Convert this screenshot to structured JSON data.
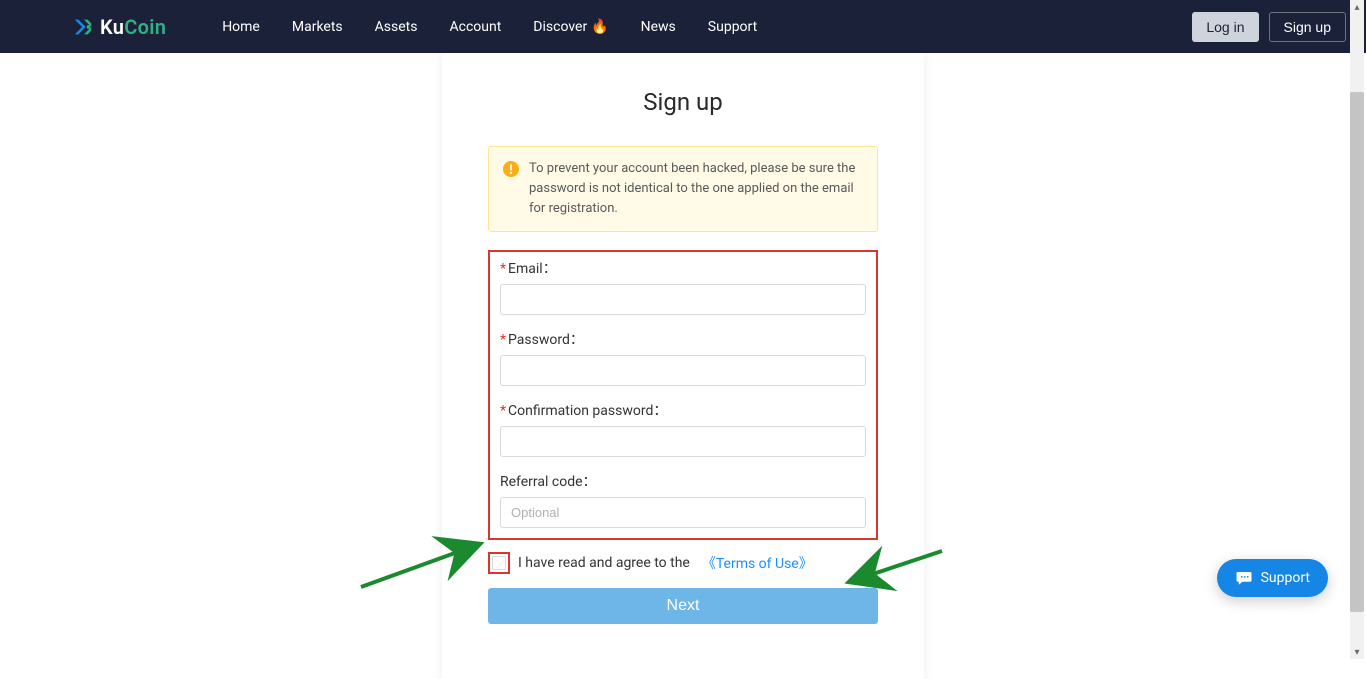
{
  "nav": {
    "brand_part1": "Ku",
    "brand_part2": "Coin",
    "links": [
      "Home",
      "Markets",
      "Assets",
      "Account",
      "Discover",
      "News",
      "Support"
    ],
    "login_label": "Log in",
    "signup_label": "Sign up"
  },
  "card": {
    "title": "Sign up",
    "alert_text": "To prevent your account been hacked, please be sure the password is not identical to the one applied on the email for registration."
  },
  "fields": {
    "email_label": "Email：",
    "password_label": "Password：",
    "confirm_label": "Confirmation password：",
    "referral_label": "Referral code：",
    "referral_placeholder": "Optional"
  },
  "consent": {
    "text": "I have read and agree to the",
    "link": "《Terms of Use》"
  },
  "next_label": "Next",
  "support_label": "Support"
}
